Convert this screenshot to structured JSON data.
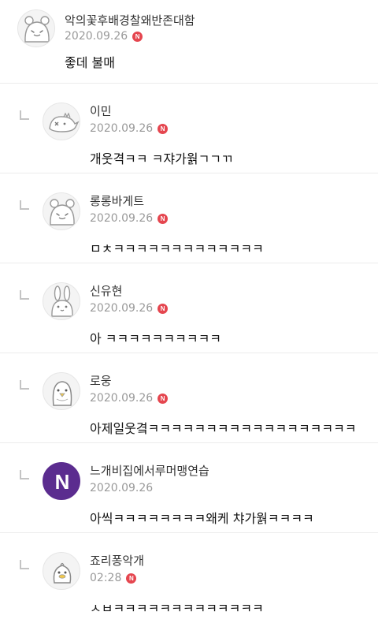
{
  "badge": {
    "label": "N",
    "color": "#e5464f"
  },
  "comments": [
    {
      "nickname": "악의꽃후배경찰왜반존대함",
      "date": "2020.09.26",
      "text": "좋데 불매",
      "avatar": "hamster-avatar-icon"
    },
    {
      "nickname": "이민",
      "date": "2020.09.26",
      "text": "개웃격ㅋㅋ ㅋ쟈가웕ㄱㄱㄲ",
      "avatar": "dinosaur-avatar-icon"
    },
    {
      "nickname": "롱롱바게트",
      "date": "2020.09.26",
      "text": "ㅁㅊㅋㅋㅋㅋㅋㅋㅋㅋㅋㅋㅋㅋㅋ",
      "avatar": "hamster-avatar-icon"
    },
    {
      "nickname": "신유현",
      "date": "2020.09.26",
      "text": "아 ㅋㅋㅋㅋㅋㅋㅋㅋㅋㅋ",
      "avatar": "rabbit-avatar-icon"
    },
    {
      "nickname": "로웅",
      "date": "2020.09.26",
      "text": "아제일웃곀ㅋㅋㅋㅋㅋㅋㅋㅋㅋㅋㅋㅋㅋㅋㅋㅋㅋㅋ",
      "avatar": "penguin-avatar-icon"
    },
    {
      "nickname": "느개비집에서루머맹연습",
      "date": "2020.09.26",
      "text": "아씩ㅋㅋㅋㅋㅋㅋㅋㅋ왜케 챠가웕ㅋㅋㅋㅋ",
      "avatar": "letter-n-avatar-icon",
      "avatar_letter": "N",
      "avatar_color": "#5b2c8f"
    },
    {
      "nickname": "죠리퐁악개",
      "date": "02:28",
      "text": "ㅅㅂㅋㅋㅋㅋㅋㅋㅋㅋㅋㅋㅋㅋㅋ",
      "avatar": "duck-avatar-icon"
    }
  ]
}
